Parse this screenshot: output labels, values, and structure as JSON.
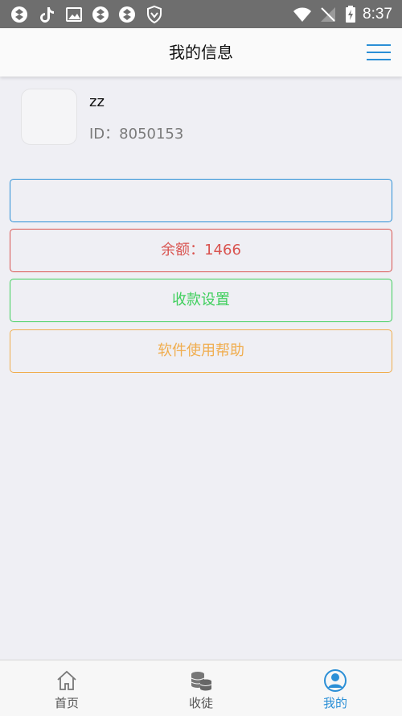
{
  "status_bar": {
    "time": "8:37",
    "icons": [
      "app-icon",
      "tiktok-icon",
      "gallery-icon",
      "app-icon",
      "app-icon",
      "shield-icon",
      "wifi-icon",
      "no-signal-icon",
      "battery-charging-icon"
    ]
  },
  "header": {
    "title": "我的信息",
    "menu_icon": "menu-icon"
  },
  "profile": {
    "name": "zz",
    "id_text": "ID：8050153"
  },
  "rows": [
    {
      "label": "",
      "color": "#2b8fd6"
    },
    {
      "label": "余额：1466",
      "color": "#d9534f"
    },
    {
      "label": "收款设置",
      "color": "#3fcf5c"
    },
    {
      "label": "软件使用帮助",
      "color": "#f0ad4e"
    }
  ],
  "tabs": [
    {
      "label": "首页",
      "icon": "home-icon",
      "active": false
    },
    {
      "label": "收徒",
      "icon": "coins-icon",
      "active": false
    },
    {
      "label": "我的",
      "icon": "user-icon",
      "active": true
    }
  ],
  "colors": {
    "accent": "#2b8fd6",
    "status_bar": "#6e6e6e",
    "background": "#efeff4"
  }
}
